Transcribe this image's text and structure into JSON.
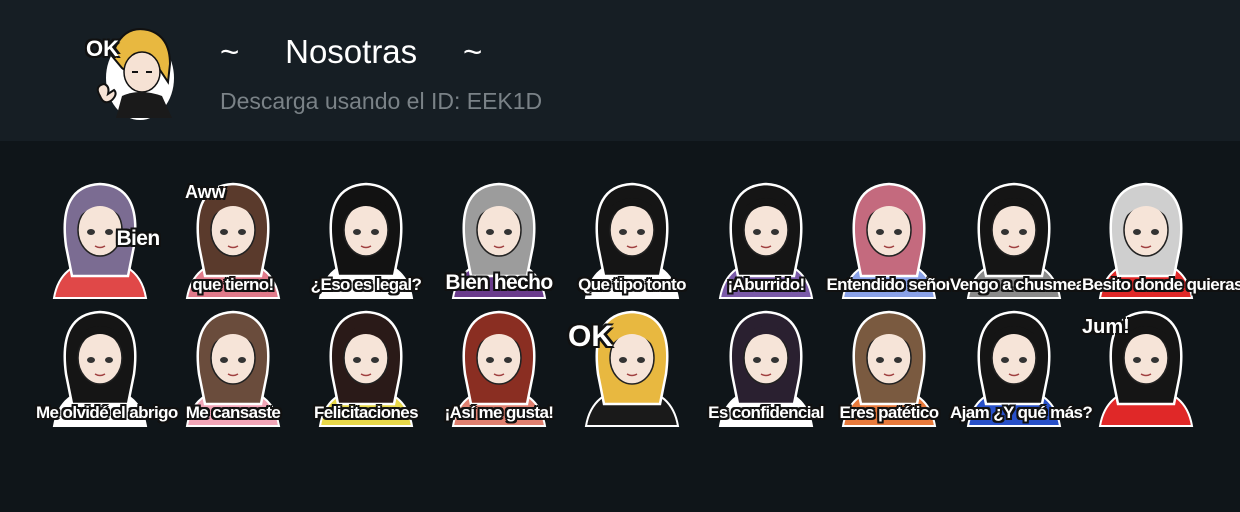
{
  "header": {
    "title": "~     Nosotras     ~",
    "subtitle": "Descarga usando el ID: EEK1D",
    "avatar_label": "OK"
  },
  "stickers": [
    {
      "caption": "Bien",
      "extra": "",
      "hair": "#7b6c92",
      "accent": "#e04848"
    },
    {
      "caption": "que tierno!",
      "extra": "Aww",
      "hair": "#5a3a2c",
      "accent": "#e07a8a"
    },
    {
      "caption": "¿Eso es legal?",
      "extra": "",
      "hair": "#121212",
      "accent": "#ffffff"
    },
    {
      "caption": "Bien hecho",
      "extra": "",
      "hair": "#9c9c9c",
      "accent": "#6a3c8c"
    },
    {
      "caption": "Que tipo tonto",
      "extra": "",
      "hair": "#151515",
      "accent": "#ffffff"
    },
    {
      "caption": "¡Aburrido!",
      "extra": "",
      "hair": "#151515",
      "accent": "#7a5aa8"
    },
    {
      "caption": "Entendido señor",
      "extra": "",
      "hair": "#c46a7e",
      "accent": "#8aa2e8"
    },
    {
      "caption": "Vengo a chusmear",
      "extra": "",
      "hair": "#151515",
      "accent": "#8a8a8a"
    },
    {
      "caption": "Besito donde quieras",
      "extra": "",
      "hair": "#cfcfcf",
      "accent": "#e02828"
    },
    {
      "caption": "Me olvidé el abrigo",
      "extra": "",
      "hair": "#151515",
      "accent": "#ffffff"
    },
    {
      "caption": "Me cansaste",
      "extra": "",
      "hair": "#6a4c3c",
      "accent": "#f2a6b8"
    },
    {
      "caption": "Felicitaciones",
      "extra": "",
      "hair": "#2a1a18",
      "accent": "#e8d84a"
    },
    {
      "caption": "¡Así me gusta!",
      "extra": "",
      "hair": "#8a2e22",
      "accent": "#e08070"
    },
    {
      "caption": "",
      "extra": "OK",
      "hair": "#e8b840",
      "accent": "#1a1a1a"
    },
    {
      "caption": "Es confidencial",
      "extra": "",
      "hair": "#2a2030",
      "accent": "#ffffff"
    },
    {
      "caption": "Eres patético",
      "extra": "",
      "hair": "#7a5a40",
      "accent": "#e87a3c"
    },
    {
      "caption": "Ajam ¿Y qué más?",
      "extra": "",
      "hair": "#151515",
      "accent": "#2850c8"
    },
    {
      "caption": "",
      "extra": "Jum!",
      "hair": "#151515",
      "accent": "#e02828"
    }
  ]
}
